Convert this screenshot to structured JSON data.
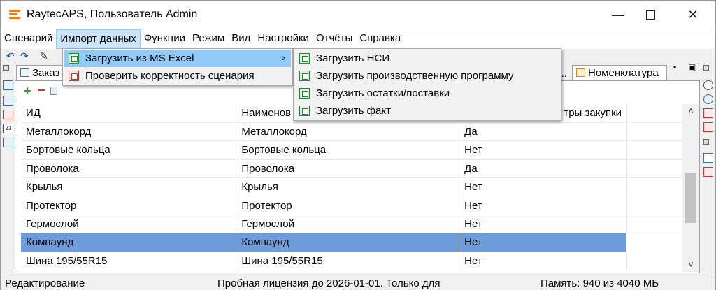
{
  "window": {
    "title": "RaytecAPS, Пользователь Admin"
  },
  "menubar": {
    "items": [
      "Сценарий",
      "Импорт данных",
      "Функции",
      "Режим",
      "Вид",
      "Настройки",
      "Отчёты",
      "Справка"
    ],
    "active_index": 1
  },
  "tabs": {
    "left": "Заказ",
    "right": "Номенклатура",
    "right_prefix": "..."
  },
  "grid": {
    "columns": [
      "ИД",
      "Наименов",
      "",
      "тры закупки"
    ],
    "rows": [
      [
        "Металлокорд",
        "Металлокорд",
        "Да",
        ""
      ],
      [
        "Бортовые кольца",
        "Бортовые кольца",
        "Нет",
        ""
      ],
      [
        "Проволока",
        "Проволока",
        "Да",
        ""
      ],
      [
        "Крылья",
        "Крылья",
        "Нет",
        ""
      ],
      [
        "Протектор",
        "Протектор",
        "Нет",
        ""
      ],
      [
        "Гермослой",
        "Гермослой",
        "Нет",
        ""
      ],
      [
        "Компаунд",
        "Компаунд",
        "Нет",
        ""
      ],
      [
        "Шина 195/55R15",
        "Шина 195/55R15",
        "Нет",
        ""
      ]
    ],
    "selected_index": 6
  },
  "import_menu": {
    "items": [
      "Загрузить из MS Excel",
      "Проверить корректность сценария"
    ]
  },
  "excel_submenu": {
    "items": [
      "Загрузить НСИ",
      "Загрузить производственную программу",
      "Загрузить остатки/поставки",
      "Загрузить факт"
    ]
  },
  "statusbar": {
    "mode": "Редактирование",
    "license": "Пробная лицензия до 2026-01-01. Только для",
    "memory": "Память: 940 из 4040 МБ"
  },
  "colors": {
    "selection": "#6d9cdc",
    "menu_highlight": "#91c9f7",
    "logo": "#f07a1a"
  }
}
